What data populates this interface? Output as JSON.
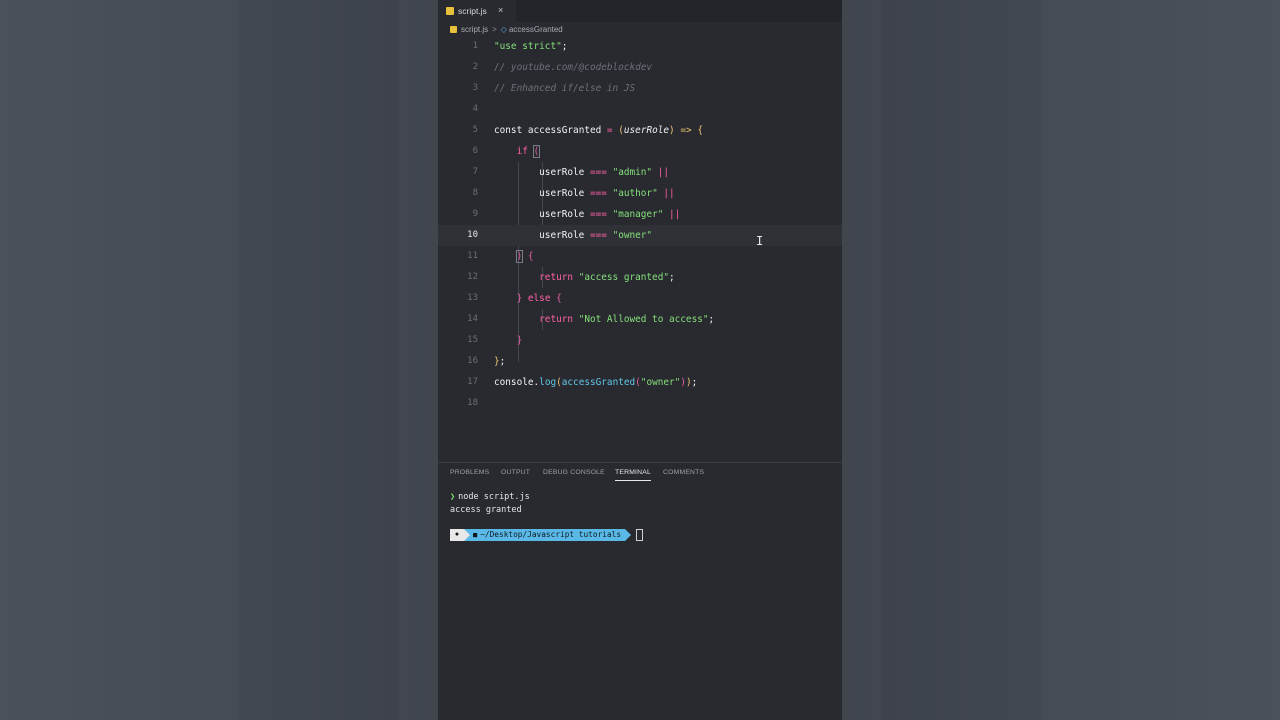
{
  "tab": {
    "filename": "script.js",
    "close_glyph": "×",
    "icon": "js-file-icon"
  },
  "breadcrumb": {
    "file": "script.js",
    "separator": ">",
    "symbol": "accessGranted",
    "symbol_icon": "symbol-variable-icon"
  },
  "editor": {
    "active_line": "10",
    "lines": [
      {
        "n": "1"
      },
      {
        "n": "2"
      },
      {
        "n": "3"
      },
      {
        "n": "4"
      },
      {
        "n": "5"
      },
      {
        "n": "6"
      },
      {
        "n": "7"
      },
      {
        "n": "8"
      },
      {
        "n": "9"
      },
      {
        "n": "10"
      },
      {
        "n": "11"
      },
      {
        "n": "12"
      },
      {
        "n": "13"
      },
      {
        "n": "14"
      },
      {
        "n": "15"
      },
      {
        "n": "16"
      },
      {
        "n": "17"
      },
      {
        "n": "18"
      }
    ],
    "code": {
      "l1_str": "\"use strict\"",
      "l1_semi": ";",
      "l2": "// youtube.com/@codeblockdev",
      "l3": "// Enhanced if/else in JS",
      "l5_const": "const",
      "l5_name": "accessGranted",
      "l5_eq": "=",
      "l5_lp": "(",
      "l5_param": "userRole",
      "l5_rp": ")",
      "l5_arrow": "=>",
      "l5_lb": "{",
      "l6_if": "if",
      "l6_lp": "(",
      "l7_id": "userRole",
      "l7_op": "===",
      "l7_str": "\"admin\"",
      "l7_or": "||",
      "l8_id": "userRole",
      "l8_op": "===",
      "l8_str": "\"author\"",
      "l8_or": "||",
      "l9_id": "userRole",
      "l9_op": "===",
      "l9_str": "\"manager\"",
      "l9_or": "||",
      "l10_id": "userRole",
      "l10_op": "===",
      "l10_str": "\"owner\"",
      "l11_rp": ")",
      "l11_lb": "{",
      "l12_ret": "return",
      "l12_str": "\"access granted\"",
      "l12_semi": ";",
      "l13_rb": "}",
      "l13_else": "else",
      "l13_lb": "{",
      "l14_ret": "return",
      "l14_str": "\"Not Allowed to access\"",
      "l14_semi": ";",
      "l15_rb": "}",
      "l16_rb": "}",
      "l16_semi": ";",
      "l17_obj": "console",
      "l17_dot": ".",
      "l17_log": "log",
      "l17_lp": "(",
      "l17_fn": "accessGranted",
      "l17_lp2": "(",
      "l17_str": "\"owner\"",
      "l17_rp2": ")",
      "l17_rp": ")",
      "l17_semi": ";"
    }
  },
  "panel": {
    "tabs": [
      "PROBLEMS",
      "OUTPUT",
      "DEBUG CONSOLE",
      "TERMINAL",
      "COMMENTS"
    ],
    "active_tab": "TERMINAL"
  },
  "terminal": {
    "prompt_glyph": "❯",
    "command": "node script.js",
    "output": "access granted",
    "prompt_path": "~/Desktop/Javascript tutorials",
    "apple_glyph": "",
    "folder_glyph": "■"
  },
  "colors": {
    "string": "#86e07a",
    "keyword": "#ff61a6",
    "function": "#62c6e8",
    "bracket": "#f0c674",
    "comment": "#6d7079",
    "editor_bg": "#282a30",
    "page_bg": "#4a4f59"
  }
}
